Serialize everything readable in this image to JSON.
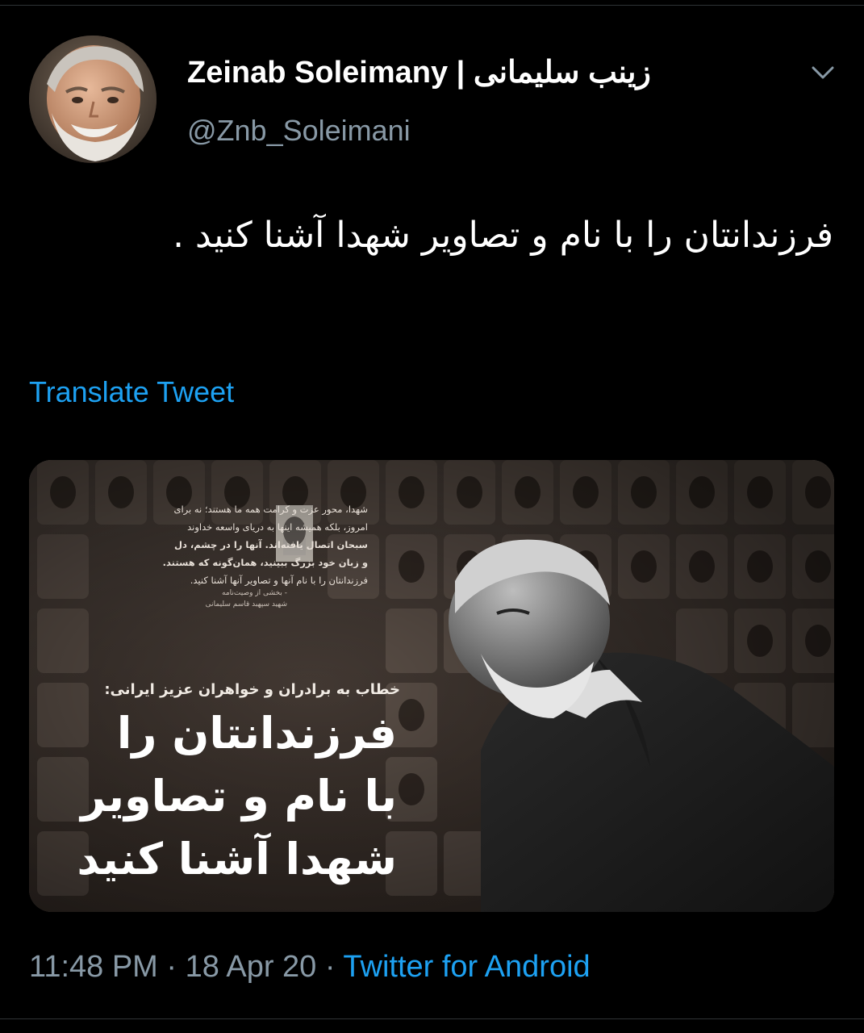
{
  "author": {
    "display_name": "Zeinab Soleimany | زینب سلیمانی",
    "handle": "@Znb_Soleimani"
  },
  "tweet": {
    "text": "فرزندانتان را با نام و تصاویر شهدا آشنا کنید .",
    "translate_label": "Translate Tweet"
  },
  "media": {
    "quote_lines": [
      "شهدا، محور عزت و کرامت همه ما هستند؛ نه برای",
      "امروز، بلکه همیشه اینها به دریای واسعه خداوند",
      "سبحان اتصال یافته‌اند. آنها را در چشم، دل",
      "و زبان خود بزرگ ببینید، همان‌گونه که هستند.",
      "فرزندانتان را با نام آنها و تصاویر آنها آشنا کنید."
    ],
    "signature_lines": [
      "- بخشی از وصیت‌نامه",
      "شهید سپهبد قاسم سلیمانی"
    ],
    "subheadline": "خطاب به برادران و خواهران عزیز ایرانی:",
    "headline_lines": [
      "فرزندانتان را",
      "با نام و تصاویر",
      "شهدا آشنا کنید"
    ]
  },
  "footer": {
    "time": "11:48 PM",
    "separator": "·",
    "date": "18 Apr 20",
    "source": "Twitter for Android"
  },
  "icons": {
    "caret": "chevron-down-icon"
  },
  "colors": {
    "background": "#000000",
    "secondary_text": "#8899a6",
    "link": "#1da1f2"
  }
}
